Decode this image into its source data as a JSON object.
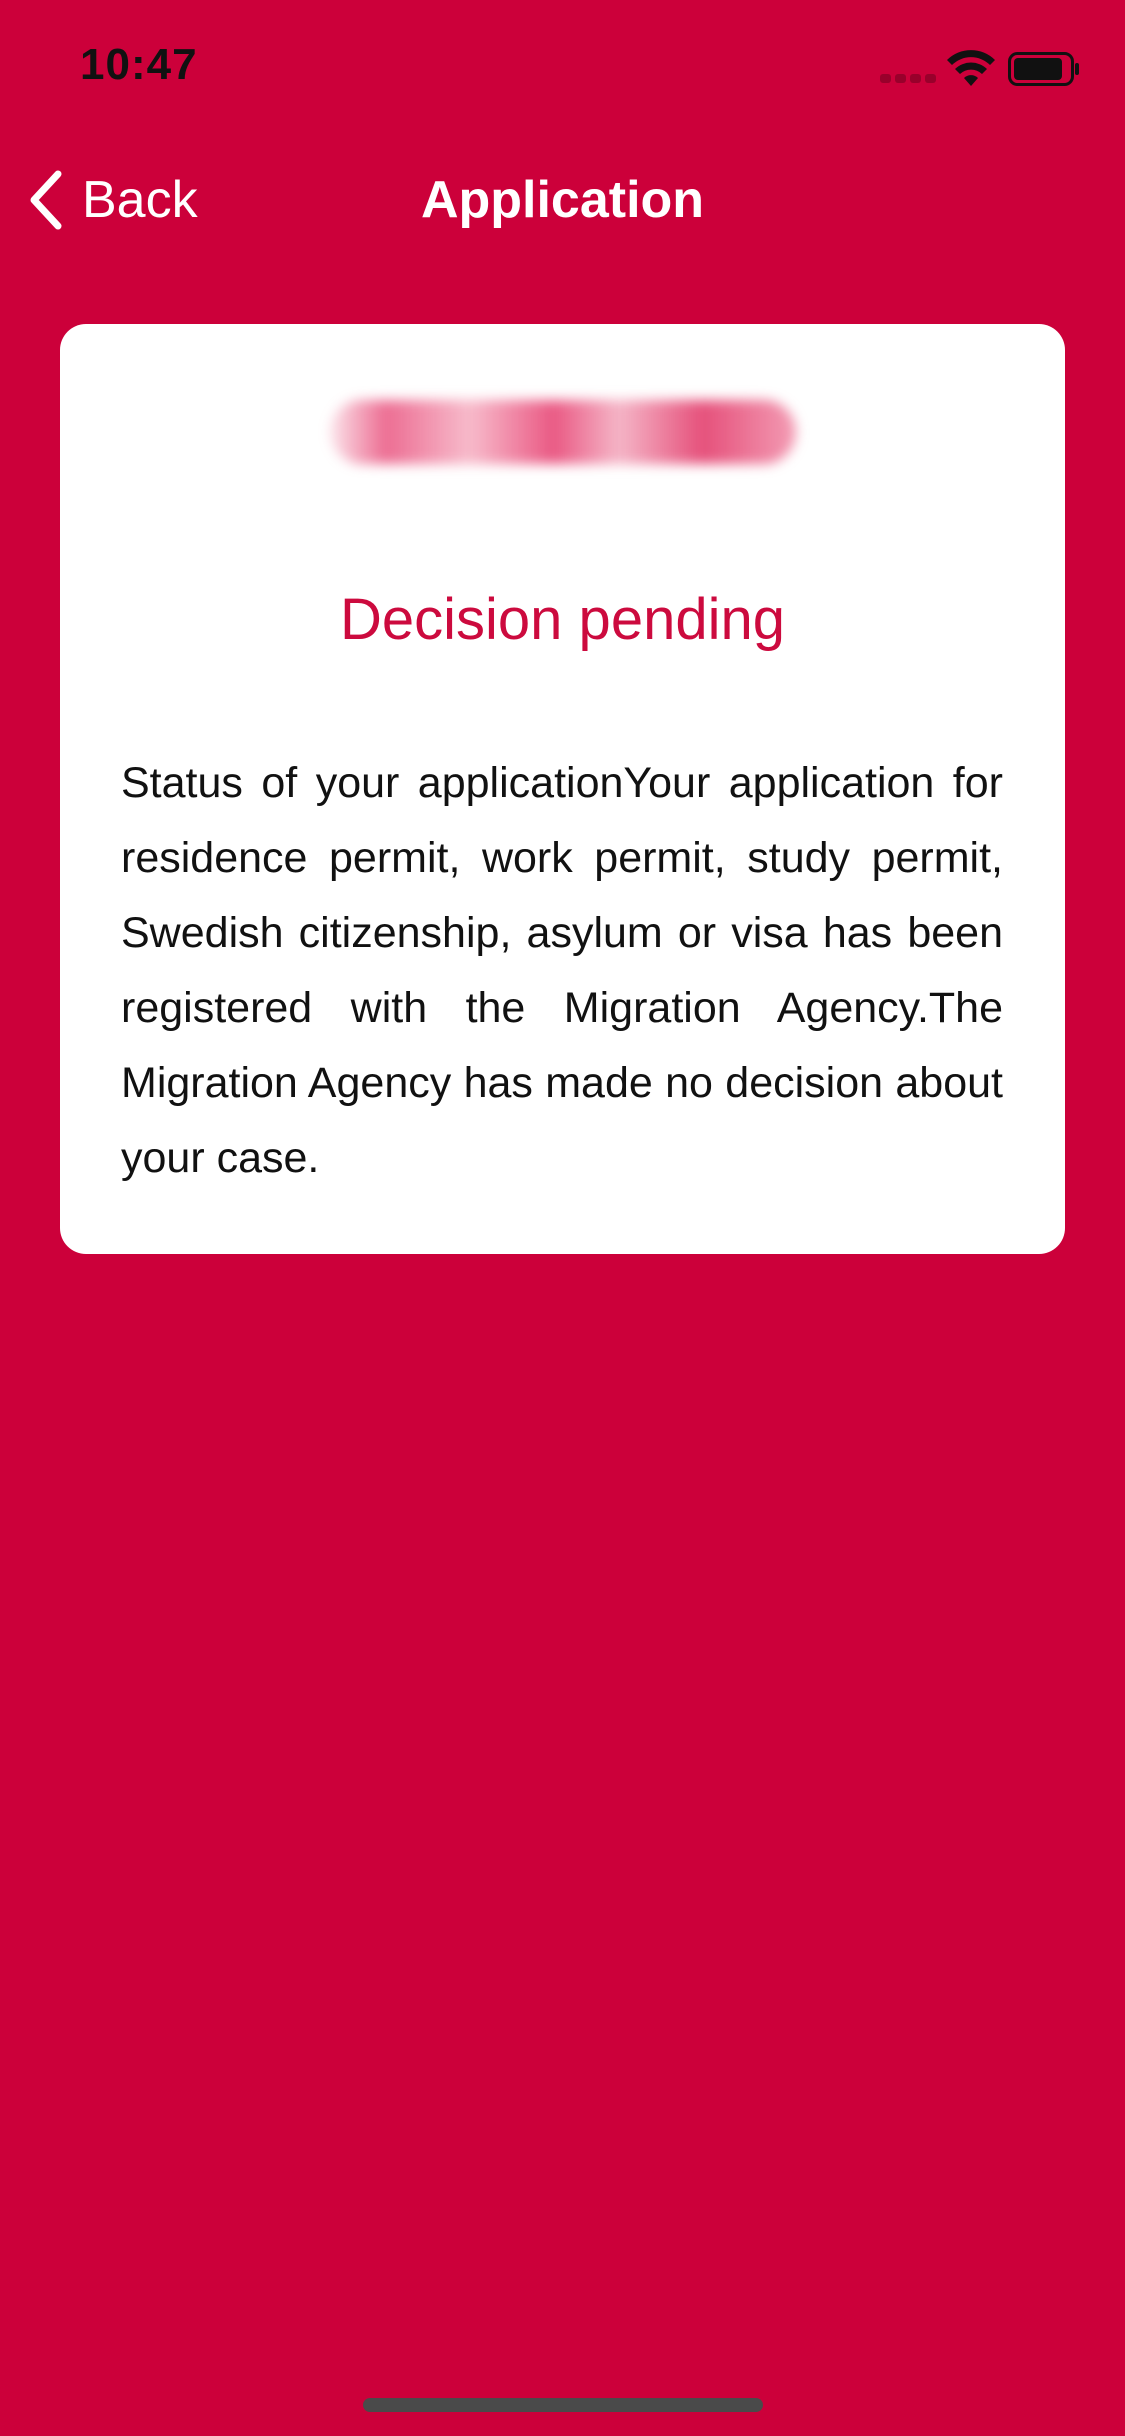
{
  "status_bar": {
    "time": "10:47",
    "icons": [
      "signal-dots-icon",
      "wifi-icon",
      "battery-icon"
    ]
  },
  "nav": {
    "back_label": "Back",
    "title": "Application",
    "back_icon": "chevron-left-icon"
  },
  "card": {
    "status_title": "Decision pending",
    "body": "Status of your applicationYour application for residence permit, work permit, study permit, Swedish citizenship, asylum or visa has been registered with the Migration Agency.The Migration Agency has made no decision about your case."
  },
  "colors": {
    "background": "#cc003a",
    "card_background": "#ffffff",
    "status_title": "#cc0a3e",
    "text": "#111111",
    "nav_text": "#ffffff"
  }
}
